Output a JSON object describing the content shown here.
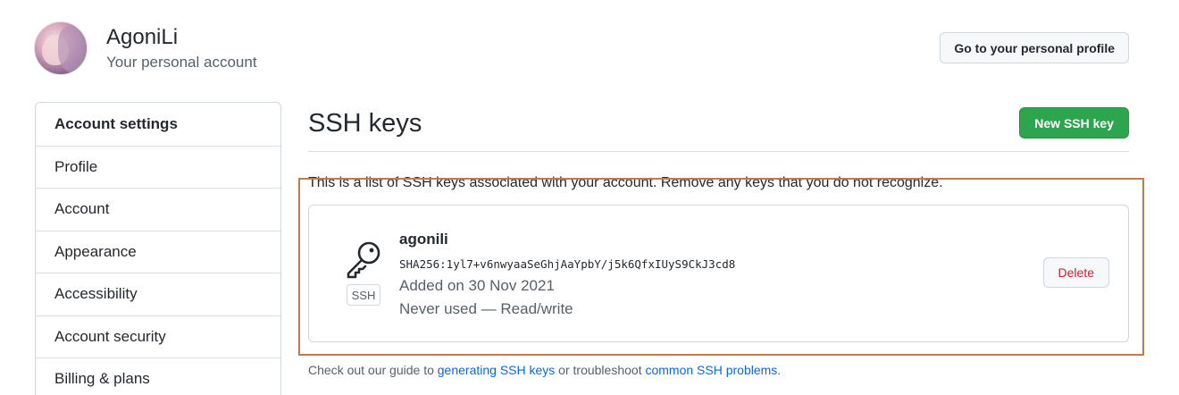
{
  "header": {
    "username": "AgoniLi",
    "account_type": "Your personal account",
    "profile_button": "Go to your personal profile"
  },
  "sidebar": {
    "items": [
      {
        "label": "Account settings"
      },
      {
        "label": "Profile"
      },
      {
        "label": "Account"
      },
      {
        "label": "Appearance"
      },
      {
        "label": "Accessibility"
      },
      {
        "label": "Account security"
      },
      {
        "label": "Billing & plans"
      }
    ]
  },
  "main": {
    "title": "SSH keys",
    "new_key_button": "New SSH key",
    "description": "This is a list of SSH keys associated with your account. Remove any keys that you do not recognize.",
    "key": {
      "badge": "SSH",
      "icon": "key-icon",
      "title": "agonili",
      "fingerprint": "SHA256:1yl7+v6nwyaaSeGhjAaYpbY/j5k6QfxIUyS9CkJ3cd8",
      "added": "Added on 30 Nov 2021",
      "usage": "Never used — Read/write",
      "delete_button": "Delete"
    },
    "footer": {
      "prefix": "Check out our guide to ",
      "link1": "generating SSH keys",
      "middle": " or troubleshoot ",
      "link2": "common SSH problems",
      "suffix": "."
    }
  },
  "colors": {
    "accent_green": "#2da44e",
    "danger_red": "#cf222e",
    "link_blue": "#0969da",
    "highlight_border": "#c07a4e"
  }
}
